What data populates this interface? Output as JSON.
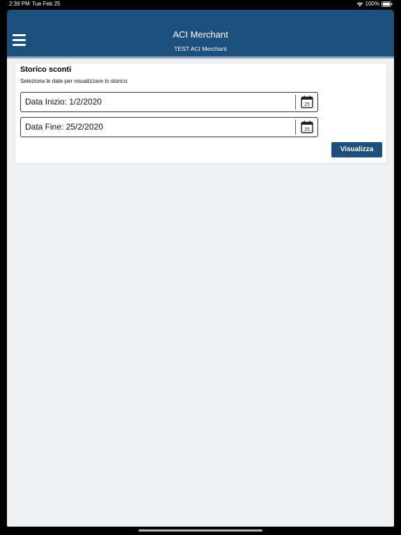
{
  "status_bar": {
    "time": "2:39 PM",
    "date": "Tue Feb 25",
    "battery": "100%",
    "wifi_icon": "wifi-icon",
    "battery_icon": "battery-icon"
  },
  "navbar": {
    "title": "ACI Merchant",
    "subtitle": "TEST ACI Merchant",
    "menu_icon": "hamburger-menu-icon",
    "color": "#1d4f7c"
  },
  "card": {
    "title": "Storico sconti",
    "description": "Seleziona le date per visualizzare lo storico:",
    "start_date": "Data Inizio: 1/2/2020",
    "end_date": "Data Fine: 25/2/2020",
    "calendar_icon": "calendar-icon",
    "calendar_day": "25",
    "view_button_label": "Visualizza"
  },
  "colors": {
    "primary": "#1d4f7c",
    "background": "#eef0f2",
    "card": "#ffffff"
  }
}
